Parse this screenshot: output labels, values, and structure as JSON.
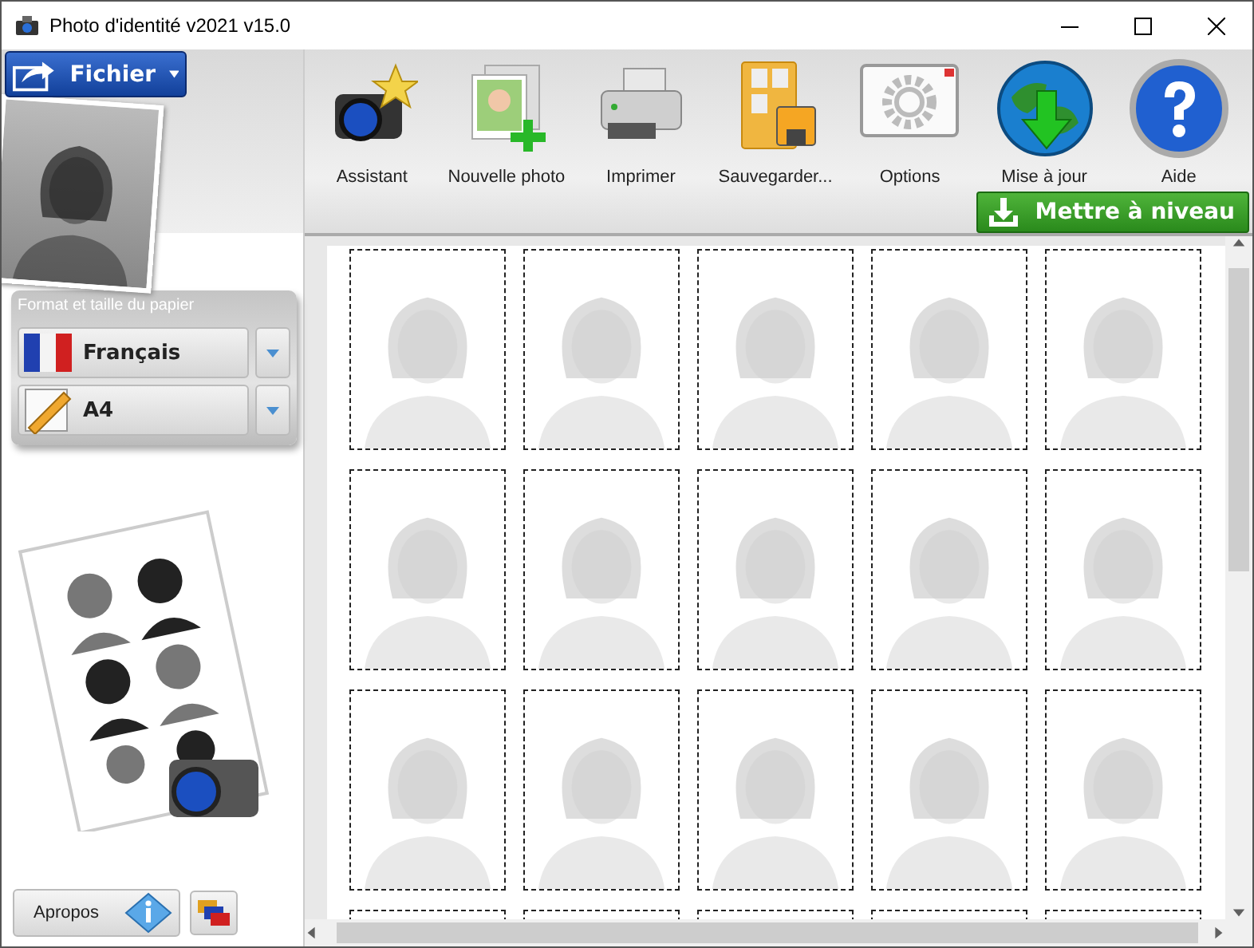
{
  "window": {
    "title": "Photo d'identité v2021 v15.0"
  },
  "file_menu": {
    "label": "Fichier"
  },
  "toolbar": [
    {
      "kind": "wizard",
      "label": "Assistant"
    },
    {
      "kind": "new",
      "label": "Nouvelle photo"
    },
    {
      "kind": "print",
      "label": "Imprimer"
    },
    {
      "kind": "save",
      "label": "Sauvegarder..."
    },
    {
      "kind": "options",
      "label": "Options"
    },
    {
      "kind": "update",
      "label": "Mise à jour"
    },
    {
      "kind": "help",
      "label": "Aide"
    }
  ],
  "upgrade_button": {
    "label": "Mettre à niveau"
  },
  "paper_panel": {
    "title": "Format et taille du papier",
    "selects": [
      {
        "kind": "language",
        "value": "Français"
      },
      {
        "kind": "size",
        "value": "A4"
      }
    ]
  },
  "about_button": {
    "label": "Apropos"
  }
}
